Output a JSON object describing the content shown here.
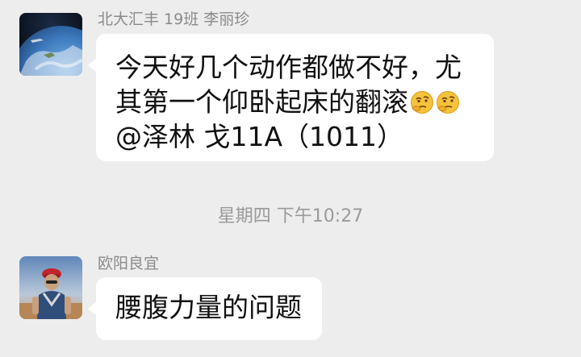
{
  "messages": [
    {
      "sender": "北大汇丰 19班 李丽珍",
      "lines": [
        "今天好几个动作都做不好，尤",
        "其第一个仰卧起床的翻滚",
        "@泽林 戈11A（1011）"
      ],
      "emoji": "thinking-face"
    },
    {
      "sender": "欧阳良宜",
      "lines": [
        "腰腹力量的问题"
      ]
    }
  ],
  "timestamp": "星期四 下午10:27",
  "colors": {
    "background": "#ededed",
    "bubble": "#ffffff",
    "sender_text": "#8a8a8a",
    "timestamp_text": "#9a9a9a"
  }
}
